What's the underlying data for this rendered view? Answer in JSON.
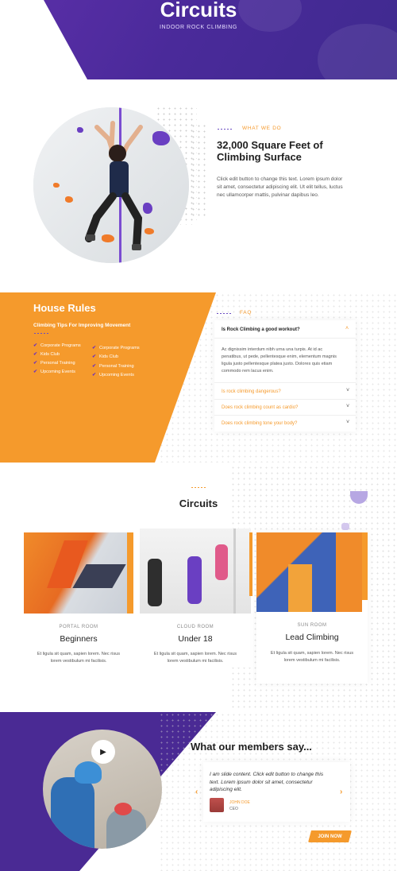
{
  "hero": {
    "title": "Circuits",
    "subtitle": "INDOOR ROCK CLIMBING"
  },
  "about": {
    "eyebrow": "WHAT WE DO",
    "heading_line1": "32,000 Square Feet of",
    "heading_line2": "Climbing Surface",
    "body_line1": "Click edit button to change this text. Lorem ipsum dolor",
    "body_line2": "sit amet, consectetur adipiscing elit. Ut elit tellus, luctus",
    "body_line3": "nec ullamcorper mattis, pulvinar dapibus leo."
  },
  "rules": {
    "title": "House Rules",
    "subtitle": "Climbing Tips For Improving Movement",
    "col1": [
      "Corporate Programs",
      "Kids Club",
      "Personal Training",
      "Upcoming Events"
    ],
    "col2": [
      "Corporate Programs",
      "Kids Club",
      "Personal Training",
      "Upcoming Events"
    ]
  },
  "faq": {
    "eyebrow": "FAQ",
    "open_question": "Is Rock Climbing a good workout?",
    "answer_line1": "Ac dignissim interdum nibh urna una turpis. At id ac",
    "answer_line2": "penatibus, ut pede, pellentesque enim, elementum magnis",
    "answer_line3": "ligula justo pellentesque platea justo. Dolores quis etiam",
    "answer_line4": "commodo rem lacus enim.",
    "q2": "Is rock climbing dangerous?",
    "q3": "Does rock climbing count as cardio?",
    "q4": "Does rock climbing tone your body?"
  },
  "circuits": {
    "title": "Circuits",
    "cards": [
      {
        "room": "PORTAL ROOM",
        "name": "Beginners",
        "desc1": "Et ligula sit quam, sapien lorem. Nec risus",
        "desc2": "lorem vestibulum mi facilisis."
      },
      {
        "room": "CLOUD ROOM",
        "name": "Under 18",
        "desc1": "Et ligula sit quam, sapien lorem. Nec risus",
        "desc2": "lorem vestibulum mi facilisis."
      },
      {
        "room": "SUN ROOM",
        "name": "Lead Climbing",
        "desc1": "Et ligula sit quam, sapien lorem. Nec risus",
        "desc2": "lorem vestibulum mi facilisis."
      }
    ]
  },
  "testimonials": {
    "title": "What our members say...",
    "quote_line1": "I am slide content. Click edit button to change this",
    "quote_line2": "text. Lorem ipsum dolor sit amet, consectetur",
    "quote_line3": "adipiscing elit.",
    "author": "JOHN DOE",
    "role": "CEO",
    "cta": "JOIN NOW"
  },
  "colors": {
    "purple": "#4a2a94",
    "orange": "#f59a2c"
  }
}
